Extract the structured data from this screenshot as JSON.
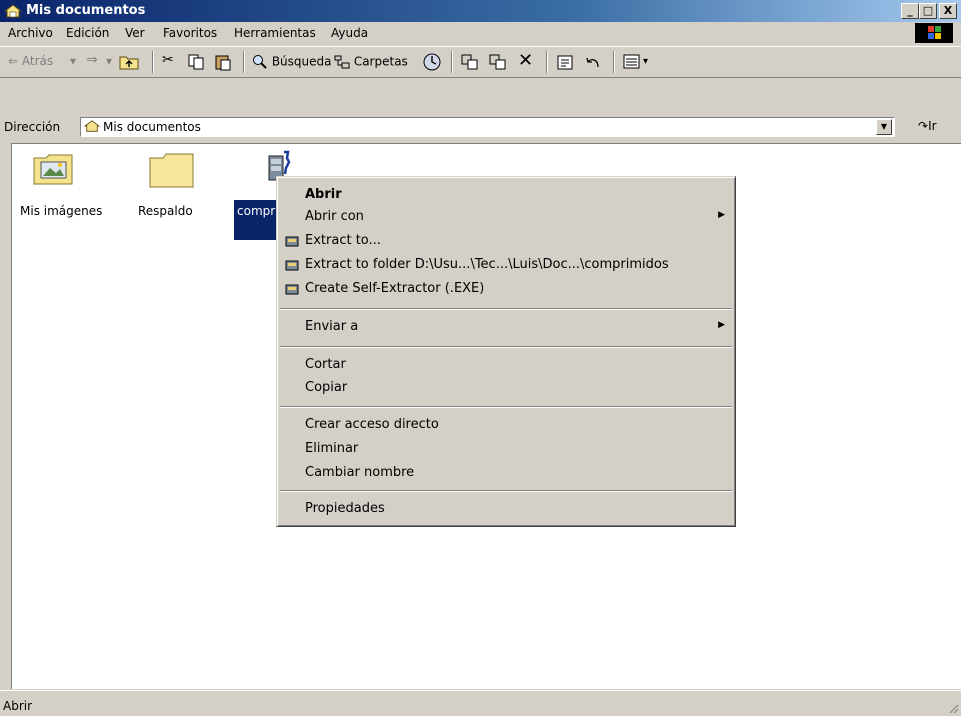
{
  "window": {
    "title": "Mis documentos",
    "min": "_",
    "max": "□",
    "close": "X"
  },
  "menubar": [
    "Archivo",
    "Edición",
    "Ver",
    "Favoritos",
    "Herramientas",
    "Ayuda"
  ],
  "toolbar": {
    "back": "Atrás",
    "search": "Búsqueda",
    "folders": "Carpetas",
    "back_arrow": "⇐",
    "forward_arrow": "⇒",
    "dropdown": "▾"
  },
  "address": {
    "label": "Dirección",
    "value": "Mis documentos",
    "go": "Ir"
  },
  "files": [
    {
      "name": "Mis imágenes",
      "type": "photos-folder-icon"
    },
    {
      "name": "Respaldo",
      "type": "folder-icon"
    },
    {
      "name": "compr",
      "type": "archive-icon",
      "selected": true
    }
  ],
  "context_menu": {
    "items": [
      {
        "label": "Abrir",
        "bold": true
      },
      {
        "label": "Abrir con",
        "submenu": true
      },
      {
        "label": "Extract to...",
        "icon": "winzip-icon"
      },
      {
        "label": "Extract to folder D:\\Usu...\\Tec...\\Luis\\Doc...\\comprimidos",
        "icon": "winzip-icon"
      },
      {
        "label": "Create Self-Extractor (.EXE)",
        "icon": "winzip-icon"
      },
      {
        "label": "Enviar a",
        "submenu": true
      },
      {
        "label": "Cortar"
      },
      {
        "label": "Copiar"
      },
      {
        "label": "Crear acceso directo"
      },
      {
        "label": "Eliminar"
      },
      {
        "label": "Cambiar nombre"
      },
      {
        "label": "Propiedades"
      }
    ],
    "submenu_arrow": "▶"
  },
  "status": {
    "text": "Abrir"
  },
  "colors": {
    "titlebar_start": "#0a246a",
    "titlebar_end": "#a6caf0",
    "selection": "#0a246a",
    "face": "#d4d0c8"
  }
}
